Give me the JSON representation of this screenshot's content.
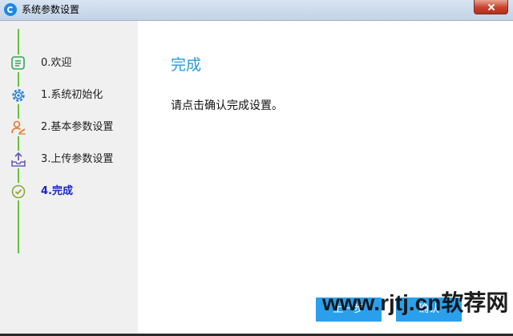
{
  "window": {
    "title": "系统参数设置"
  },
  "sidebar": {
    "steps": [
      {
        "label": "0.欢迎",
        "icon": "document-list-icon",
        "color": "#2eaa55"
      },
      {
        "label": "1.系统初始化",
        "icon": "gear-icon",
        "color": "#2b7ed6"
      },
      {
        "label": "2.基本参数设置",
        "icon": "user-edit-icon",
        "color": "#e07a2e"
      },
      {
        "label": "3.上传参数设置",
        "icon": "upload-tray-icon",
        "color": "#6b5bb5"
      },
      {
        "label": "4.完成",
        "icon": "check-circle-icon",
        "color": "#8aa83a",
        "active": true
      }
    ]
  },
  "main": {
    "title": "完成",
    "message": "请点击确认完成设置。"
  },
  "buttons": {
    "prev_label": "上一步",
    "ok_label": "确认"
  },
  "watermark": "www.rjtj.cn软荐网",
  "colors": {
    "accent": "#2aa0ec",
    "timeline": "#62c33b",
    "active_step": "#1b25c9",
    "title_blue": "#2a9ad8"
  }
}
